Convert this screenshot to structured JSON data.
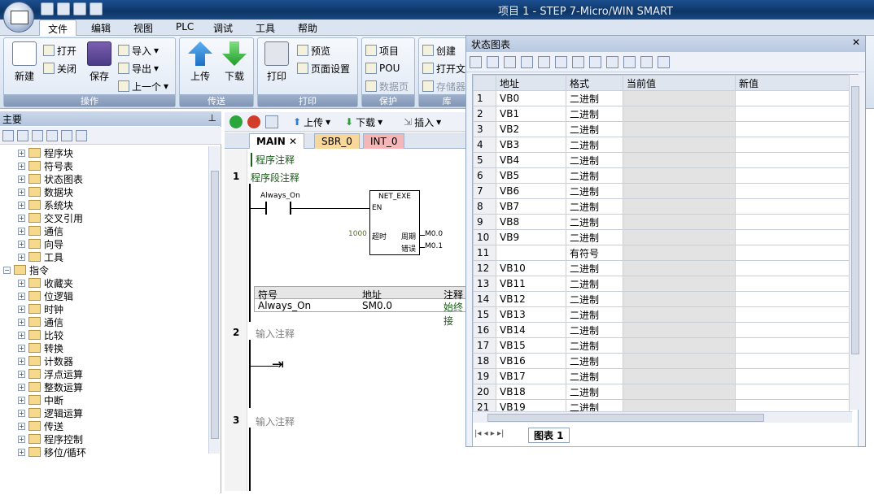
{
  "window": {
    "title": "项目 1 - STEP 7-Micro/WIN SMART"
  },
  "menu": [
    "文件",
    "编辑",
    "视图",
    "PLC",
    "调试",
    "工具",
    "帮助"
  ],
  "ribbon": {
    "file_group": {
      "new": "新建",
      "open": "打开",
      "close": "关闭",
      "save": "保存",
      "import": "导入",
      "export": "导出",
      "prev": "上一个",
      "label": "操作"
    },
    "transfer_group": {
      "upload": "上传",
      "download": "下载",
      "label": "传送"
    },
    "print_group": {
      "print": "打印",
      "preview": "预览",
      "page_setup": "页面设置",
      "label": "打印"
    },
    "protect_group": {
      "project": "项目",
      "pou": "POU",
      "datapage": "数据页",
      "label": "保护"
    },
    "lib_group": {
      "create": "创建",
      "open": "打开文",
      "memory": "存储器",
      "label": "库"
    }
  },
  "left_panel": {
    "title": "主要",
    "tree": [
      {
        "label": "程序块",
        "level": 1
      },
      {
        "label": "符号表",
        "level": 1
      },
      {
        "label": "状态图表",
        "level": 1
      },
      {
        "label": "数据块",
        "level": 1
      },
      {
        "label": "系统块",
        "level": 1
      },
      {
        "label": "交叉引用",
        "level": 1
      },
      {
        "label": "通信",
        "level": 1
      },
      {
        "label": "向导",
        "level": 1
      },
      {
        "label": "工具",
        "level": 1
      },
      {
        "label": "指令",
        "level": 0
      },
      {
        "label": "收藏夹",
        "level": 1
      },
      {
        "label": "位逻辑",
        "level": 1
      },
      {
        "label": "时钟",
        "level": 1
      },
      {
        "label": "通信",
        "level": 1
      },
      {
        "label": "比较",
        "level": 1
      },
      {
        "label": "转换",
        "level": 1
      },
      {
        "label": "计数器",
        "level": 1
      },
      {
        "label": "浮点运算",
        "level": 1
      },
      {
        "label": "整数运算",
        "level": 1
      },
      {
        "label": "中断",
        "level": 1
      },
      {
        "label": "逻辑运算",
        "level": 1
      },
      {
        "label": "传送",
        "level": 1
      },
      {
        "label": "程序控制",
        "level": 1
      },
      {
        "label": "移位/循环",
        "level": 1
      }
    ]
  },
  "editor": {
    "toolbar": {
      "upload": "上传",
      "download": "下载",
      "insert": "插入"
    },
    "tabs": [
      "MAIN",
      "SBR_0",
      "INT_0"
    ],
    "program_comment": "程序注释",
    "networks": [
      {
        "num": "1",
        "comment": "程序段注释"
      },
      {
        "num": "2",
        "comment": "输入注释"
      },
      {
        "num": "3",
        "comment": "输入注释"
      }
    ],
    "contact": "Always_On",
    "box_title": "NET_EXE",
    "box_en": "EN",
    "box_timeout_val": "1000",
    "box_timeout": "超时",
    "box_cycle": "周期",
    "box_error": "错误",
    "out_m0": "M0.0",
    "out_m1": "M0.1",
    "symtable": {
      "headers": [
        "符号",
        "地址",
        "注释"
      ],
      "row": [
        "Always_On",
        "SM0.0",
        "始终接"
      ]
    }
  },
  "status_chart": {
    "title": "状态图表",
    "headers": [
      "地址",
      "格式",
      "当前值",
      "新值"
    ],
    "rows": [
      [
        "1",
        "VB0",
        "二进制"
      ],
      [
        "2",
        "VB1",
        "二进制"
      ],
      [
        "3",
        "VB2",
        "二进制"
      ],
      [
        "4",
        "VB3",
        "二进制"
      ],
      [
        "5",
        "VB4",
        "二进制"
      ],
      [
        "6",
        "VB5",
        "二进制"
      ],
      [
        "7",
        "VB6",
        "二进制"
      ],
      [
        "8",
        "VB7",
        "二进制"
      ],
      [
        "9",
        "VB8",
        "二进制"
      ],
      [
        "10",
        "VB9",
        "二进制"
      ],
      [
        "11",
        "",
        "有符号"
      ],
      [
        "12",
        "VB10",
        "二进制"
      ],
      [
        "13",
        "VB11",
        "二进制"
      ],
      [
        "14",
        "VB12",
        "二进制"
      ],
      [
        "15",
        "VB13",
        "二进制"
      ],
      [
        "16",
        "VB14",
        "二进制"
      ],
      [
        "17",
        "VB15",
        "二进制"
      ],
      [
        "18",
        "VB16",
        "二进制"
      ],
      [
        "19",
        "VB17",
        "二进制"
      ],
      [
        "20",
        "VB18",
        "二进制"
      ],
      [
        "21",
        "VB19",
        "二进制"
      ]
    ],
    "sheet_tab": "图表 1"
  }
}
